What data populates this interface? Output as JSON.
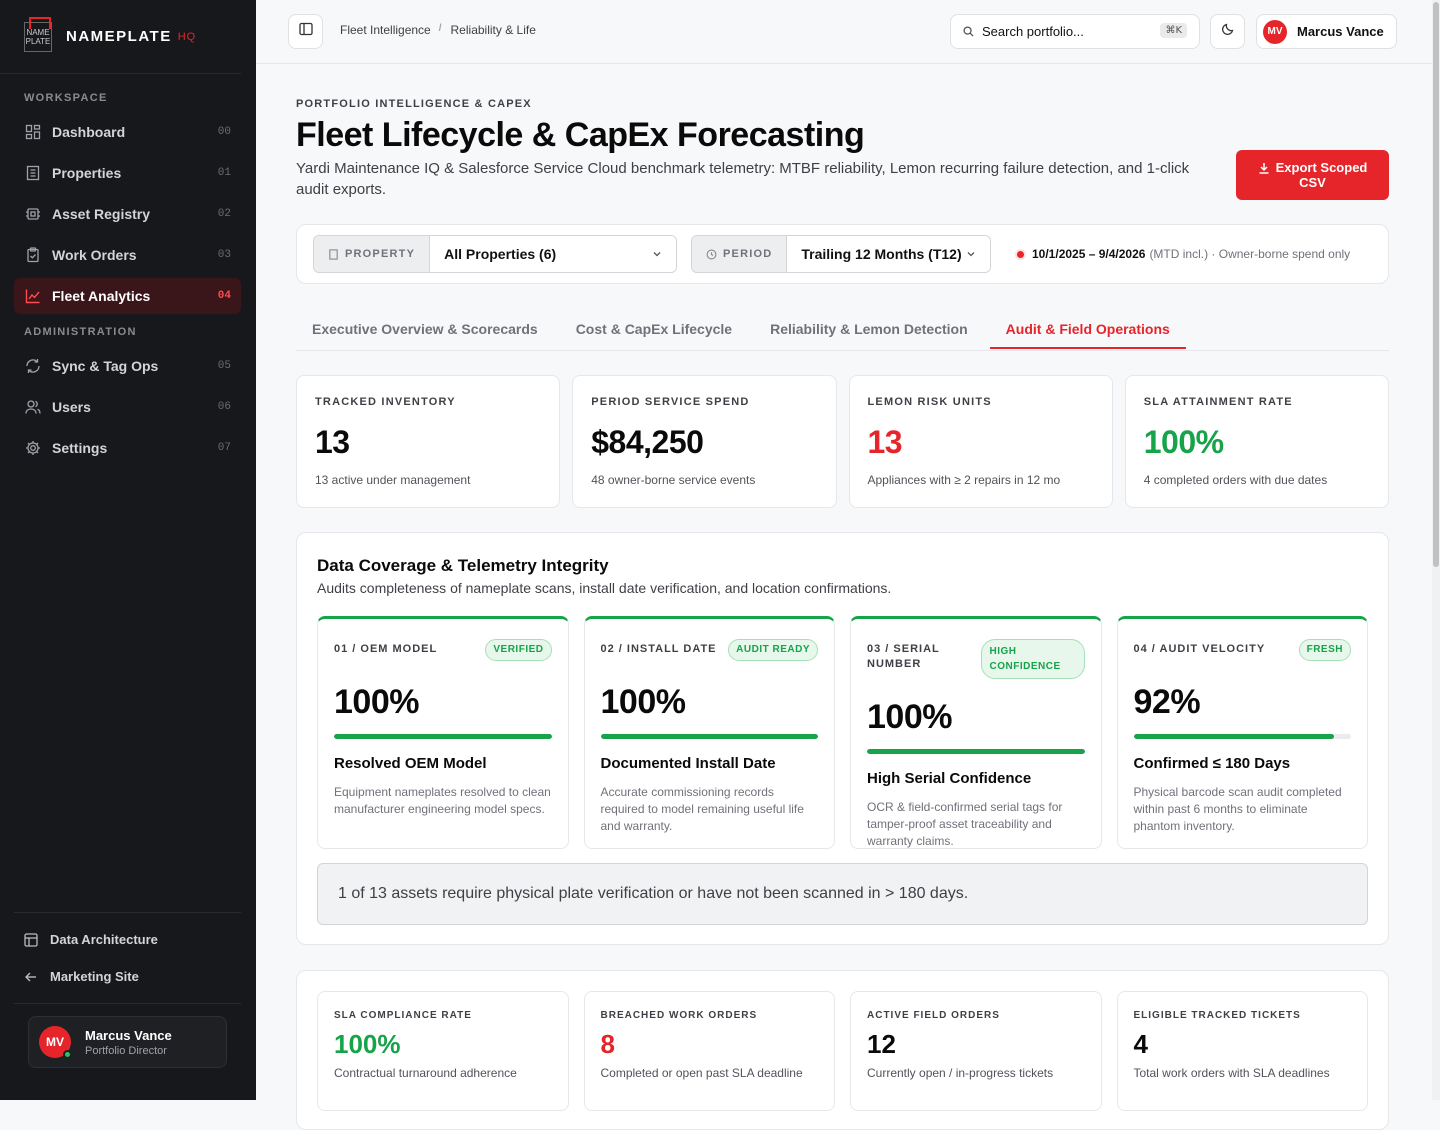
{
  "brand": {
    "name": "NAMEPLATE",
    "suffix": "HQ",
    "logo_text_1": "NAME",
    "logo_text_2": "PLATE"
  },
  "sidebar": {
    "workspace_label": "WORKSPACE",
    "admin_label": "ADMINISTRATION",
    "workspace_items": [
      {
        "label": "Dashboard",
        "num": "00",
        "icon": "dashboard-icon"
      },
      {
        "label": "Properties",
        "num": "01",
        "icon": "building-icon"
      },
      {
        "label": "Asset Registry",
        "num": "02",
        "icon": "chip-icon"
      },
      {
        "label": "Work Orders",
        "num": "03",
        "icon": "clipboard-icon"
      },
      {
        "label": "Fleet Analytics",
        "num": "04",
        "icon": "chart-icon",
        "active": true
      }
    ],
    "admin_items": [
      {
        "label": "Sync & Tag Ops",
        "num": "05",
        "icon": "tag-icon"
      },
      {
        "label": "Users",
        "num": "06",
        "icon": "users-icon"
      },
      {
        "label": "Settings",
        "num": "07",
        "icon": "gear-icon"
      }
    ],
    "bottom_links": [
      {
        "label": "Data Architecture",
        "icon": "table-icon"
      },
      {
        "label": "Marketing Site",
        "icon": "arrow-left-icon"
      }
    ],
    "user": {
      "initials": "MV",
      "name": "Marcus Vance",
      "role": "Portfolio Director"
    }
  },
  "topbar": {
    "breadcrumbs": [
      "Fleet Intelligence",
      "Reliability & Life"
    ],
    "search_placeholder": "Search portfolio...",
    "search_shortcut": "⌘K",
    "user_initials": "MV",
    "user_name": "Marcus Vance"
  },
  "header": {
    "kicker": "PORTFOLIO INTELLIGENCE & CAPEX",
    "title": "Fleet Lifecycle & CapEx Forecasting",
    "subtitle": "Yardi Maintenance IQ & Salesforce Service Cloud benchmark telemetry: MTBF reliability, Lemon recurring failure detection, and 1-click audit exports.",
    "export_line1": "Export Scoped",
    "export_line2": "CSV"
  },
  "filters": {
    "property_label": "PROPERTY",
    "property_value": "All Properties (6)",
    "period_label": "PERIOD",
    "period_value": "Trailing 12 Months (T12)",
    "range_bold": "10/1/2025 – 9/4/2026",
    "range_note": "(MTD incl.) · Owner-borne spend only"
  },
  "tabs": [
    {
      "label": "Executive Overview & Scorecards"
    },
    {
      "label": "Cost & CapEx Lifecycle"
    },
    {
      "label": "Reliability & Lemon Detection"
    },
    {
      "label": "Audit & Field Operations",
      "active": true
    }
  ],
  "kpis": [
    {
      "label": "TRACKED INVENTORY",
      "value": "13",
      "desc": "13 active under management",
      "tone": ""
    },
    {
      "label": "PERIOD SERVICE SPEND",
      "value": "$84,250",
      "desc": "48 owner-borne service events",
      "tone": ""
    },
    {
      "label": "LEMON RISK UNITS",
      "value": "13",
      "desc": "Appliances with ≥ 2 repairs in 12 mo",
      "tone": "red"
    },
    {
      "label": "SLA ATTAINMENT RATE",
      "value": "100%",
      "desc": "4 completed orders with due dates",
      "tone": "green"
    }
  ],
  "coverage": {
    "title": "Data Coverage & Telemetry Integrity",
    "subtitle": "Audits completeness of nameplate scans, install date verification, and location confirmations.",
    "cards": [
      {
        "label": "01 / OEM MODEL",
        "badge": "VERIFIED",
        "value": "100%",
        "progress": 1.0,
        "title": "Resolved OEM Model",
        "desc": "Equipment nameplates resolved to clean manufacturer engineering model specs."
      },
      {
        "label": "02 / INSTALL DATE",
        "badge": "AUDIT READY",
        "value": "100%",
        "progress": 1.0,
        "title": "Documented Install Date",
        "desc": "Accurate commissioning records required to model remaining useful life and warranty."
      },
      {
        "label": "03 / SERIAL NUMBER",
        "badge": "HIGH CONFIDENCE",
        "value": "100%",
        "progress": 1.0,
        "title": "High Serial Confidence",
        "desc": "OCR & field-confirmed serial tags for tamper-proof asset traceability and warranty claims."
      },
      {
        "label": "04 / AUDIT VELOCITY",
        "badge": "FRESH",
        "value": "92%",
        "progress": 0.92,
        "title": "Confirmed ≤ 180 Days",
        "desc": "Physical barcode scan audit completed within past 6 months to eliminate phantom inventory."
      }
    ],
    "notice": "1 of 13 assets require physical plate verification or have not been scanned in > 180 days."
  },
  "sla": [
    {
      "label": "SLA COMPLIANCE RATE",
      "value": "100%",
      "desc": "Contractual turnaround adherence",
      "tone": "green"
    },
    {
      "label": "BREACHED WORK ORDERS",
      "value": "8",
      "desc": "Completed or open past SLA deadline",
      "tone": "red"
    },
    {
      "label": "ACTIVE FIELD ORDERS",
      "value": "12",
      "desc": "Currently open / in-progress tickets",
      "tone": ""
    },
    {
      "label": "ELIGIBLE TRACKED TICKETS",
      "value": "4",
      "desc": "Total work orders with SLA deadlines",
      "tone": ""
    }
  ],
  "colors": {
    "accent": "#e5252a",
    "success": "#16a34a",
    "sidebar": "#17181b"
  }
}
